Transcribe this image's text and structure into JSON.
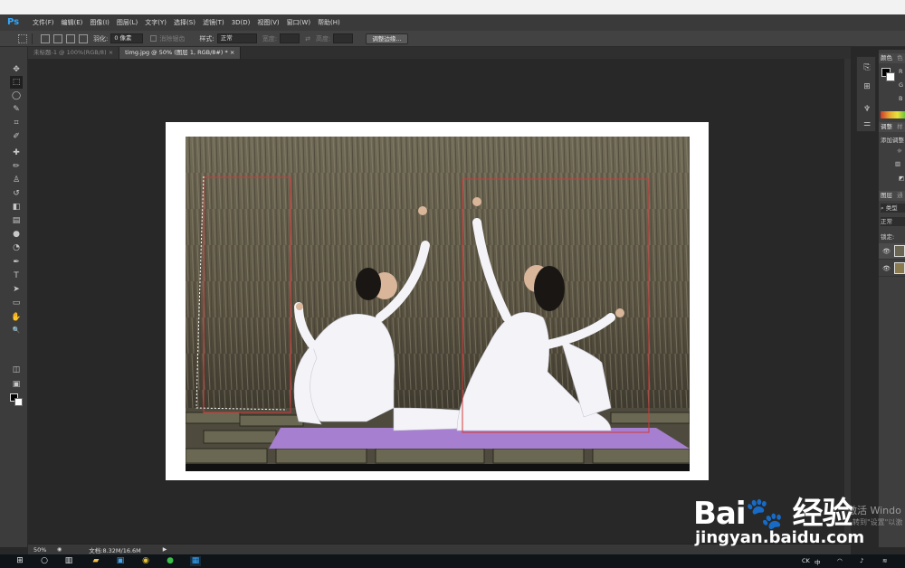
{
  "app": {
    "logo": "Ps",
    "menu": [
      "文件(F)",
      "编辑(E)",
      "图像(I)",
      "图层(L)",
      "文字(Y)",
      "选择(S)",
      "滤镜(T)",
      "3D(D)",
      "视图(V)",
      "窗口(W)",
      "帮助(H)"
    ]
  },
  "options": {
    "feather_label": "羽化:",
    "feather_value": "0 像素",
    "antialias_label": "消除锯齿",
    "style_label": "样式:",
    "style_value": "正常",
    "width_label": "宽度:",
    "height_label": "高度:",
    "refine_button": "调整边缘..."
  },
  "tabs": [
    {
      "label": "未标题-1 @ 100%(RGB/8)",
      "close": "×",
      "active": false
    },
    {
      "label": "timg.jpg @ 50% (图层 1, RGB/8#) *",
      "close": "×",
      "active": true
    }
  ],
  "tools": [
    "move-tool-icon",
    "marquee-tool-icon",
    "lasso-tool-icon",
    "quick-select-icon",
    "crop-tool-icon",
    "eyedropper-icon",
    "healing-brush-icon",
    "brush-tool-icon",
    "clone-stamp-icon",
    "history-brush-icon",
    "eraser-icon",
    "gradient-icon",
    "blur-icon",
    "dodge-icon",
    "pen-tool-icon",
    "type-tool-icon",
    "path-select-icon",
    "rectangle-tool-icon",
    "hand-tool-icon",
    "zoom-tool-icon"
  ],
  "tool_glyphs": [
    "✥",
    "⬚",
    "◯",
    "✎",
    "⌗",
    "✐",
    "✚",
    "✏",
    "♙",
    "↺",
    "◧",
    "▤",
    "●",
    "◔",
    "✒",
    "T",
    "➤",
    "▭",
    "✋",
    "🔍"
  ],
  "status": {
    "zoom": "50%",
    "doc_info": "文档:8.32M/16.6M",
    "arrow": "▶"
  },
  "right_panel": {
    "color_tab": "颜色",
    "color_tab2": "色",
    "r_label": "R",
    "g_label": "G",
    "b_label": "B",
    "adjust_tab": "调整",
    "adjust_tab2": "样",
    "add_adjust": "添加调整",
    "layers_tab": "图层",
    "layers_tab2": "通",
    "kind_label": "类型",
    "blend_value": "正常",
    "lock_label": "锁定:"
  },
  "taskbar": {
    "tray_lang": "CK",
    "tray_ime": "中"
  },
  "watermark": {
    "activate": "激活 Windo",
    "activate_sub": "转到\"设置\"以激",
    "brand": "Bai🐾 经验",
    "url": "jingyan.baidu.com"
  },
  "colors": {
    "accent_ps": "#31a8ff",
    "selection_red": "#d23a3a",
    "mat_purple": "#a67fd0"
  }
}
